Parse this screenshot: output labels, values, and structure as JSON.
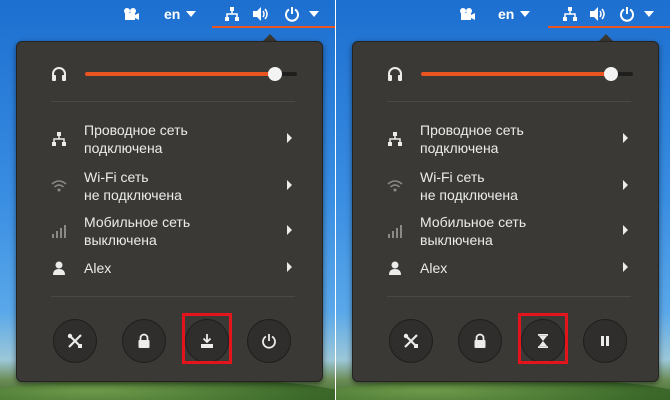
{
  "topbar": {
    "language": "en"
  },
  "menu": {
    "wired": {
      "line1": "Проводное сеть",
      "line2": "подключена"
    },
    "wifi": {
      "line1": "Wi-Fi сеть",
      "line2": "не подключена"
    },
    "mobile": {
      "line1": "Мобильное сеть",
      "line2": "выключена"
    },
    "user": {
      "name": "Alex"
    }
  },
  "volume": {
    "level_fraction": 0.9
  },
  "left_panel": {
    "buttons": [
      "settings-icon",
      "lock-icon",
      "suspend-icon",
      "power-icon"
    ],
    "highlighted": "suspend-button"
  },
  "right_panel": {
    "buttons": [
      "settings-icon",
      "lock-icon",
      "hibernate-icon",
      "pause-icon"
    ],
    "highlighted": "hibernate-button"
  },
  "colors": {
    "accent": "#e95420",
    "panel_bg": "#3a3936",
    "highlight_box": "#e3141b",
    "desktop_blue": "#3a8ee2"
  }
}
